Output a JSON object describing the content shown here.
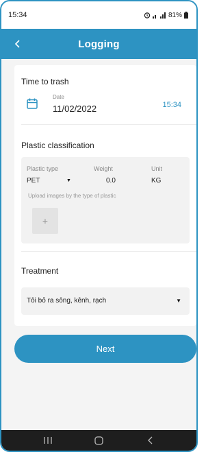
{
  "status_bar": {
    "time": "15:34",
    "battery": "81%"
  },
  "header": {
    "title": "Logging",
    "back_icon": "chevron-left-icon"
  },
  "time_to_trash": {
    "title": "Time to trash",
    "date_label": "Date",
    "date_value": "11/02/2022",
    "time_value": "15:34",
    "icon": "calendar-icon"
  },
  "plastic": {
    "title": "Plastic classification",
    "type_label": "Plastic type",
    "weight_label": "Weight",
    "unit_label": "Unit",
    "type_value": "PET",
    "weight_value": "0.0",
    "unit_value": "KG",
    "upload_label": "Upload images by the type of plastic",
    "upload_symbol": "+"
  },
  "treatment": {
    "title": "Treatment",
    "selected": "Tôi bỏ ra sông, kênh, rạch"
  },
  "actions": {
    "next_label": "Next"
  },
  "colors": {
    "accent": "#2d93c2",
    "background": "#f4f4f4",
    "nav": "#1e1e1e"
  }
}
